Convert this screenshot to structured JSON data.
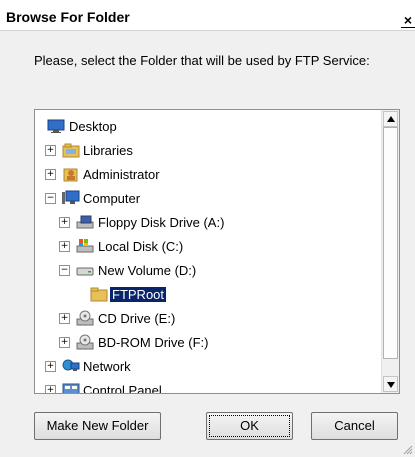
{
  "window": {
    "title": "Browse For Folder",
    "close_glyph": "×"
  },
  "instruction": "Please, select the Folder that will be used by FTP Service:",
  "tree": {
    "items": [
      {
        "label": "Desktop",
        "icon": "desktop-icon",
        "expander": ""
      },
      {
        "label": "Libraries",
        "icon": "libraries-icon",
        "expander": "+"
      },
      {
        "label": "Administrator",
        "icon": "user-icon",
        "expander": "+"
      },
      {
        "label": "Computer",
        "icon": "computer-icon",
        "expander": "−"
      },
      {
        "label": "Floppy Disk Drive (A:)",
        "icon": "floppy-icon",
        "expander": "+"
      },
      {
        "label": "Local Disk (C:)",
        "icon": "local-disk-icon",
        "expander": "+"
      },
      {
        "label": "New Volume (D:)",
        "icon": "drive-icon",
        "expander": "−"
      },
      {
        "label": "FTPRoot",
        "icon": "folder-icon",
        "expander": ""
      },
      {
        "label": "CD Drive (E:)",
        "icon": "cd-drive-icon",
        "expander": "+"
      },
      {
        "label": "BD-ROM Drive (F:)",
        "icon": "bd-rom-icon",
        "expander": "+"
      },
      {
        "label": "Network",
        "icon": "network-icon",
        "expander": "+"
      },
      {
        "label": "Control Panel",
        "icon": "control-panel-icon",
        "expander": "+"
      }
    ]
  },
  "buttons": {
    "make_new_folder": "Make New Folder",
    "ok": "OK",
    "cancel": "Cancel"
  },
  "colors": {
    "selection": "#0a246a",
    "folder": "#e8c05a"
  }
}
